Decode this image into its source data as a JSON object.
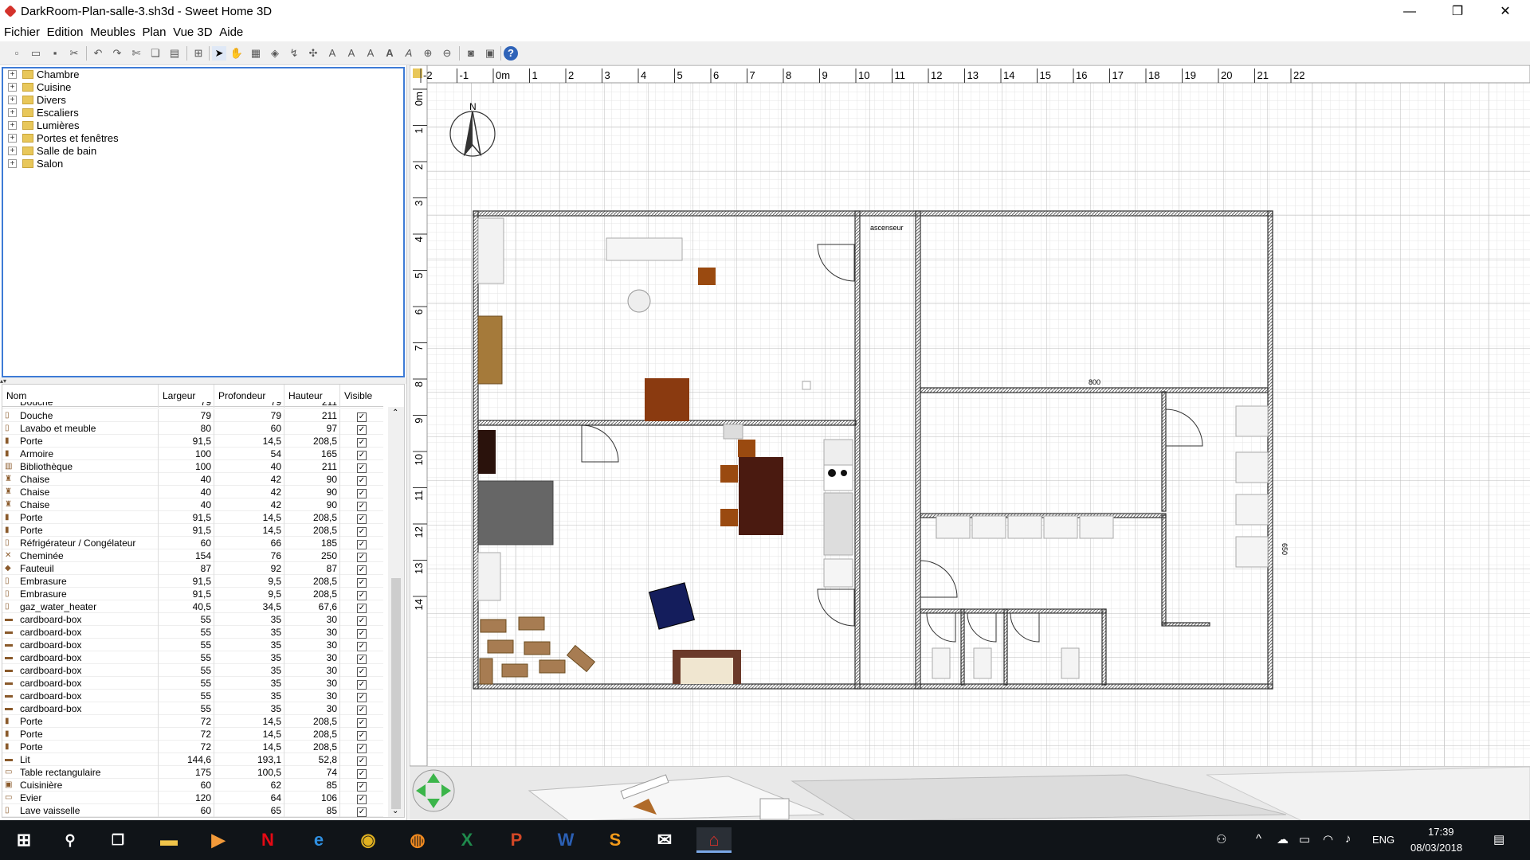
{
  "window": {
    "title": "DarkRoom-Plan-salle-3.sh3d - Sweet Home 3D"
  },
  "menu": [
    "Fichier",
    "Edition",
    "Meubles",
    "Plan",
    "Vue 3D",
    "Aide"
  ],
  "catalog": [
    "Chambre",
    "Cuisine",
    "Divers",
    "Escaliers",
    "Lumières",
    "Portes et fenêtres",
    "Salle de bain",
    "Salon"
  ],
  "furniture_table": {
    "headers": [
      "Nom",
      "Largeur",
      "Profondeur",
      "Hauteur",
      "Visible"
    ],
    "partial_top_row": {
      "name": "Douche",
      "l": "79",
      "p": "79",
      "h": "211"
    },
    "rows": [
      {
        "name": "Douche",
        "l": "79",
        "p": "79",
        "h": "211"
      },
      {
        "name": "Lavabo et meuble",
        "l": "80",
        "p": "60",
        "h": "97"
      },
      {
        "name": "Porte",
        "l": "91,5",
        "p": "14,5",
        "h": "208,5"
      },
      {
        "name": "Armoire",
        "l": "100",
        "p": "54",
        "h": "165"
      },
      {
        "name": "Bibliothèque",
        "l": "100",
        "p": "40",
        "h": "211"
      },
      {
        "name": "Chaise",
        "l": "40",
        "p": "42",
        "h": "90"
      },
      {
        "name": "Chaise",
        "l": "40",
        "p": "42",
        "h": "90"
      },
      {
        "name": "Chaise",
        "l": "40",
        "p": "42",
        "h": "90"
      },
      {
        "name": "Porte",
        "l": "91,5",
        "p": "14,5",
        "h": "208,5"
      },
      {
        "name": "Porte",
        "l": "91,5",
        "p": "14,5",
        "h": "208,5"
      },
      {
        "name": "Réfrigérateur / Congélateur",
        "l": "60",
        "p": "66",
        "h": "185"
      },
      {
        "name": "Cheminée",
        "l": "154",
        "p": "76",
        "h": "250"
      },
      {
        "name": "Fauteuil",
        "l": "87",
        "p": "92",
        "h": "87"
      },
      {
        "name": "Embrasure",
        "l": "91,5",
        "p": "9,5",
        "h": "208,5"
      },
      {
        "name": "Embrasure",
        "l": "91,5",
        "p": "9,5",
        "h": "208,5"
      },
      {
        "name": "gaz_water_heater",
        "l": "40,5",
        "p": "34,5",
        "h": "67,6"
      },
      {
        "name": "cardboard-box",
        "l": "55",
        "p": "35",
        "h": "30"
      },
      {
        "name": "cardboard-box",
        "l": "55",
        "p": "35",
        "h": "30"
      },
      {
        "name": "cardboard-box",
        "l": "55",
        "p": "35",
        "h": "30"
      },
      {
        "name": "cardboard-box",
        "l": "55",
        "p": "35",
        "h": "30"
      },
      {
        "name": "cardboard-box",
        "l": "55",
        "p": "35",
        "h": "30"
      },
      {
        "name": "cardboard-box",
        "l": "55",
        "p": "35",
        "h": "30"
      },
      {
        "name": "cardboard-box",
        "l": "55",
        "p": "35",
        "h": "30"
      },
      {
        "name": "cardboard-box",
        "l": "55",
        "p": "35",
        "h": "30"
      },
      {
        "name": "Porte",
        "l": "72",
        "p": "14,5",
        "h": "208,5"
      },
      {
        "name": "Porte",
        "l": "72",
        "p": "14,5",
        "h": "208,5"
      },
      {
        "name": "Porte",
        "l": "72",
        "p": "14,5",
        "h": "208,5"
      },
      {
        "name": "Lit",
        "l": "144,6",
        "p": "193,1",
        "h": "52,8"
      },
      {
        "name": "Table rectangulaire",
        "l": "175",
        "p": "100,5",
        "h": "74"
      },
      {
        "name": "Cuisinière",
        "l": "60",
        "p": "62",
        "h": "85"
      },
      {
        "name": "Evier",
        "l": "120",
        "p": "64",
        "h": "106"
      },
      {
        "name": "Lave vaisselle",
        "l": "60",
        "p": "65",
        "h": "85"
      }
    ]
  },
  "plan": {
    "ruler_x": [
      "-2",
      "-1",
      "0m",
      "1",
      "2",
      "3",
      "4",
      "5",
      "6",
      "7",
      "8",
      "9",
      "10",
      "11",
      "12",
      "13",
      "14",
      "15",
      "16",
      "17",
      "18",
      "19",
      "20",
      "21",
      "22"
    ],
    "ruler_y": [
      "0m",
      "1",
      "2",
      "3",
      "4",
      "5",
      "6",
      "7",
      "8",
      "9",
      "10",
      "11",
      "12",
      "13",
      "14"
    ],
    "label_elevator": "ascenseur",
    "dim_800": "800",
    "dim_650": "650",
    "compass_n": "N"
  },
  "taskbar": {
    "lang": "ENG",
    "time": "17:39",
    "date": "08/03/2018"
  }
}
